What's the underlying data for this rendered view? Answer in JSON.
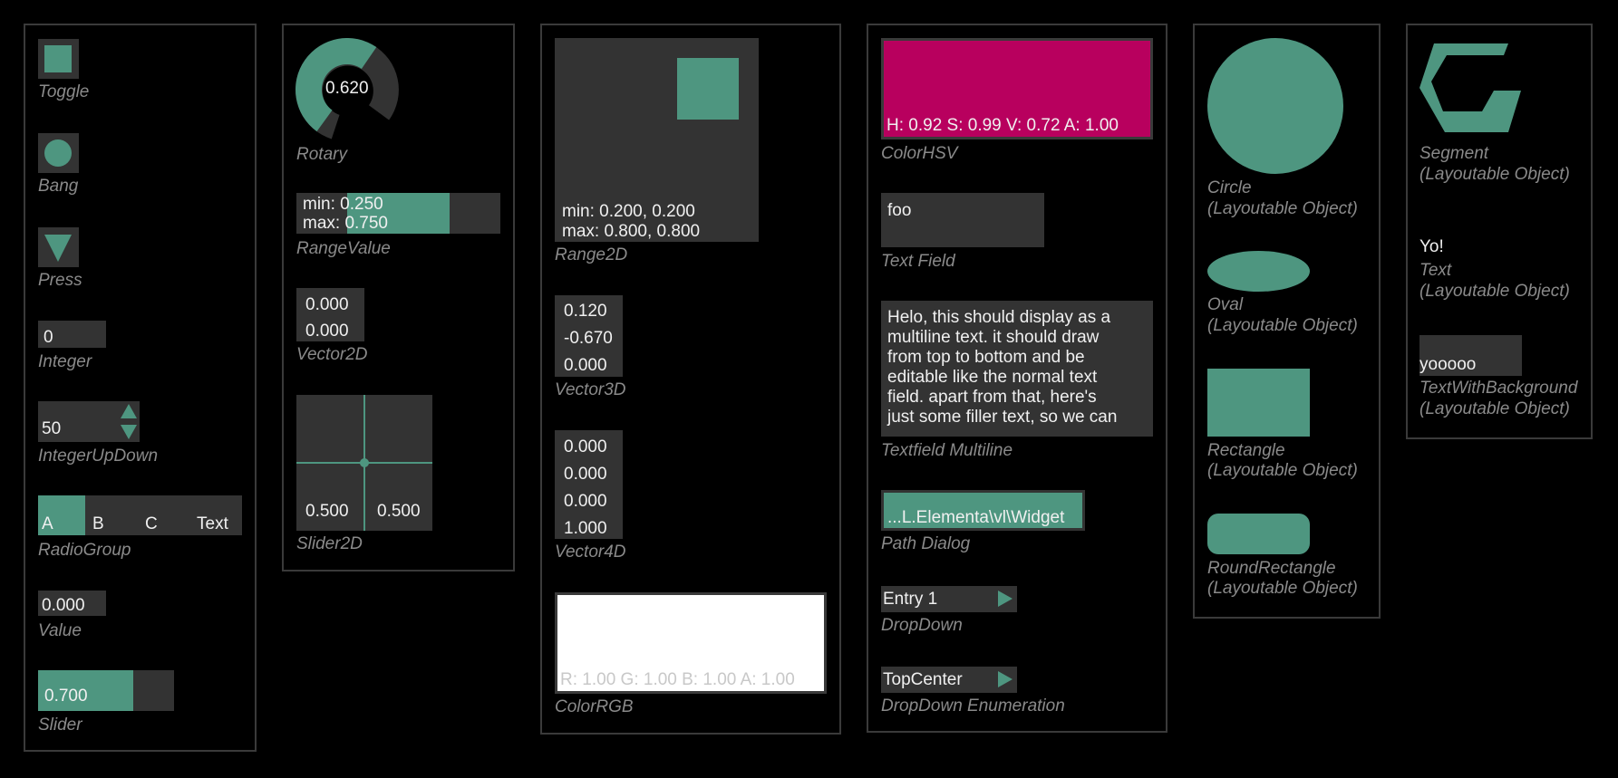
{
  "colors": {
    "accent": "#4e9680",
    "widget_bg": "#333333",
    "label": "#8a8a8a",
    "text": "#f0f0f0",
    "hsv_color": "#b8005e",
    "panel_border": "#3a3a3a"
  },
  "col1": {
    "toggle_label": "Toggle",
    "bang_label": "Bang",
    "press_label": "Press",
    "integer": {
      "value": "0",
      "label": "Integer"
    },
    "updown": {
      "value": "50",
      "label": "IntegerUpDown"
    },
    "radio": {
      "options": [
        "A",
        "B",
        "C",
        "Text"
      ],
      "selected": "A",
      "label": "RadioGroup"
    },
    "value": {
      "value": "0.000",
      "label": "Value"
    },
    "slider": {
      "value": "0.700",
      "fraction": 0.7,
      "label": "Slider"
    }
  },
  "col2": {
    "rotary": {
      "value": "0.620",
      "fraction": 0.62,
      "label": "Rotary"
    },
    "range": {
      "min": "min: 0.250",
      "max": "max: 0.750",
      "min_value": 0.25,
      "max_value": 0.75,
      "label": "RangeValue"
    },
    "vector2d": {
      "values": [
        "0.000",
        "0.000"
      ],
      "label": "Vector2D"
    },
    "slider2d": {
      "x": "0.500",
      "y": "0.500",
      "label": "Slider2D"
    }
  },
  "col3": {
    "range2d": {
      "min": "min: 0.200, 0.200",
      "max": "max: 0.800, 0.800",
      "label": "Range2D"
    },
    "vector3d": {
      "values": [
        "0.120",
        "-0.670",
        "0.000"
      ],
      "label": "Vector3D"
    },
    "vector4d": {
      "values": [
        "0.000",
        "0.000",
        "0.000",
        "1.000"
      ],
      "label": "Vector4D"
    },
    "colorrgb": {
      "text": "R: 1.00  G: 1.00  B: 1.00  A: 1.00",
      "label": "ColorRGB"
    }
  },
  "col4": {
    "colorhsv": {
      "text": "H: 0.92  S: 0.99  V: 0.72  A: 1.00",
      "label": "ColorHSV"
    },
    "textfield": {
      "value": "foo",
      "label": "Text Field"
    },
    "multiline": {
      "lines": [
        "Helo, this should display as a",
        "multiline text. it should draw",
        "from top to bottom and be",
        "editable like the normal text",
        "field. apart from that, here's",
        "just some filler text, so we can"
      ],
      "label": "Textfield Multiline"
    },
    "pathdialog": {
      "value": "...L.Elementa\\vl\\Widget",
      "label": "Path Dialog"
    },
    "dropdown": {
      "value": "Entry 1",
      "label": "DropDown"
    },
    "dropdown_enum": {
      "value": "TopCenter",
      "label": "DropDown Enumeration"
    }
  },
  "col5": {
    "circle": [
      "Circle",
      "(Layoutable Object)"
    ],
    "oval": [
      "Oval",
      "(Layoutable Object)"
    ],
    "rectangle": [
      "Rectangle",
      "(Layoutable Object)"
    ],
    "roundrect": [
      "RoundRectangle",
      "(Layoutable Object)"
    ]
  },
  "col6": {
    "segment": [
      "Segment",
      "(Layoutable Object)"
    ],
    "text_value": "Yo!",
    "text": [
      "Text",
      "(Layoutable Object)"
    ],
    "textbg_value": "yooooo",
    "textbg": [
      "TextWithBackground",
      "(Layoutable Object)"
    ]
  }
}
